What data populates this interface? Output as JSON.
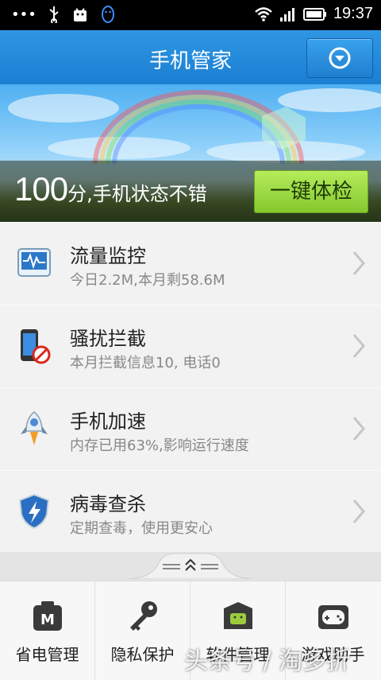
{
  "status_bar": {
    "time": "19:37"
  },
  "header": {
    "title": "手机管家"
  },
  "banner": {
    "score": "100",
    "score_text": "分,手机状态不错",
    "checkup_label": "一键体检"
  },
  "rows": [
    {
      "title": "流量监控",
      "subtitle": "今日2.2M,本月剩58.6M",
      "icon": "traffic-monitor-icon"
    },
    {
      "title": "骚扰拦截",
      "subtitle": "本月拦截信息10, 电话0",
      "icon": "harassment-block-icon"
    },
    {
      "title": "手机加速",
      "subtitle": "内存已用63%,影响运行速度",
      "icon": "rocket-icon"
    },
    {
      "title": "病毒查杀",
      "subtitle": "定期查毒，使用更安心",
      "icon": "virus-shield-icon"
    }
  ],
  "dock": [
    {
      "label": "省电管理",
      "icon": "battery-manage-icon"
    },
    {
      "label": "隐私保护",
      "icon": "key-icon"
    },
    {
      "label": "软件管理",
      "icon": "app-box-icon"
    },
    {
      "label": "游戏助手",
      "icon": "gamepad-icon"
    }
  ],
  "watermark": "头条号 / 淘多折",
  "colors": {
    "header_blue": "#1b7fd2",
    "checkup_green": "#9bd843"
  }
}
